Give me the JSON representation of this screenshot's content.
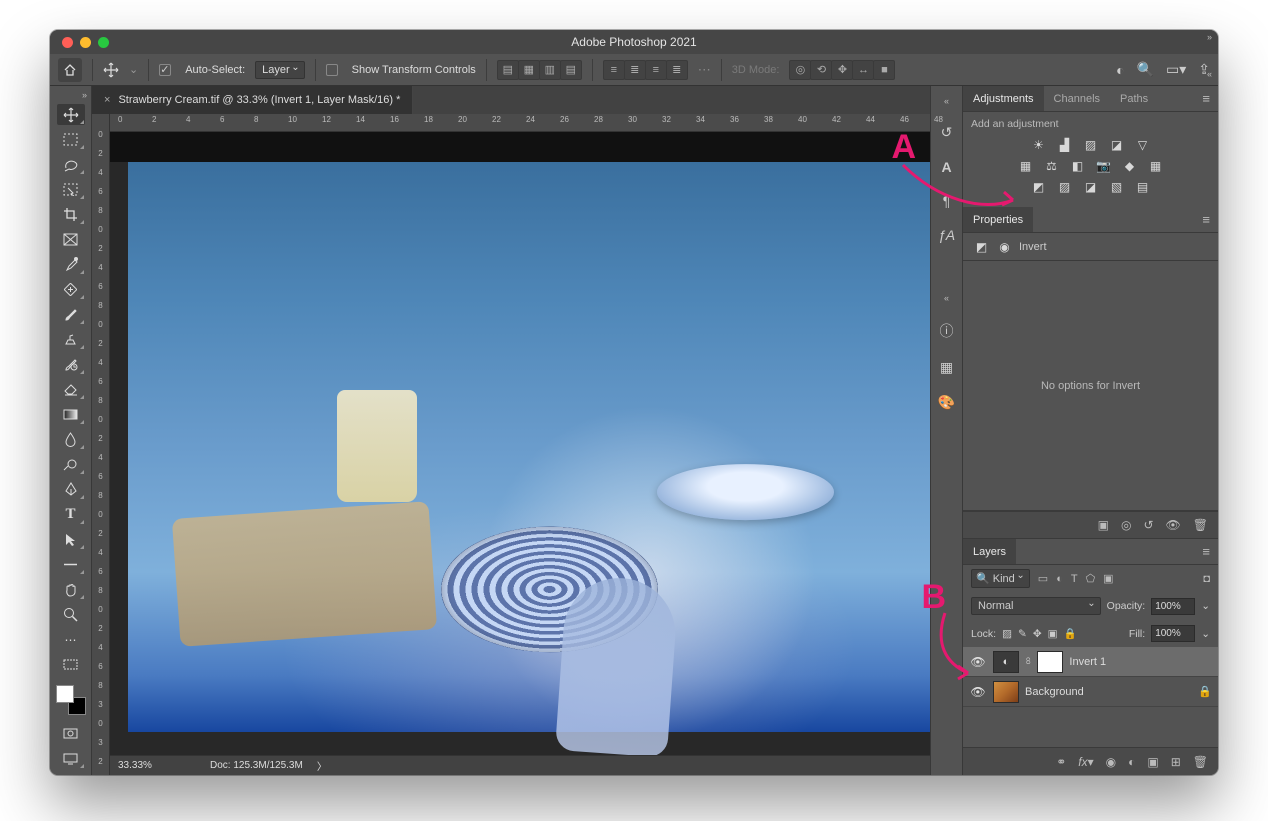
{
  "traffic": [
    "close",
    "minimize",
    "zoom"
  ],
  "titlebar": "Adobe Photoshop 2021",
  "optionsbar": {
    "auto_select": {
      "checked": true,
      "label": "Auto-Select:"
    },
    "target": "Layer",
    "show_transform": {
      "checked": false,
      "label": "Show Transform Controls"
    },
    "mode3d_label": "3D Mode:"
  },
  "document": {
    "tab": "Strawberry Cream.tif @ 33.3% (Invert 1, Layer Mask/16) *",
    "zoom": "33.33%",
    "doc_size": "Doc: 125.3M/125.3M"
  },
  "ruler_h": [
    "0",
    "2",
    "4",
    "6",
    "8",
    "10",
    "12",
    "14",
    "16",
    "18",
    "20",
    "22",
    "24",
    "26",
    "28",
    "30",
    "32",
    "34",
    "36",
    "38",
    "40",
    "42",
    "44",
    "46",
    "48"
  ],
  "ruler_v": [
    "0",
    "2",
    "4",
    "6",
    "8",
    "0",
    "2",
    "4",
    "6",
    "8",
    "0",
    "2",
    "4",
    "6",
    "8",
    "0",
    "2",
    "4",
    "6",
    "8",
    "0",
    "2",
    "4",
    "6",
    "8",
    "0",
    "2",
    "4",
    "6",
    "8",
    "3",
    "0",
    "3",
    "2"
  ],
  "collapsed_icons": {
    "row1": [
      "history-icon",
      "character-icon",
      "paragraph-icon",
      "glyphs-icon"
    ],
    "row2": [
      "info-icon",
      "swatches-icon",
      "color-icon"
    ]
  },
  "adjustments_panel": {
    "tabs": [
      "Adjustments",
      "Channels",
      "Paths"
    ],
    "active": 0,
    "add_label": "Add an adjustment",
    "row1": [
      "brightness",
      "levels",
      "curves",
      "exposure",
      "vibrance"
    ],
    "row2": [
      "hue",
      "balance",
      "bw",
      "photo-filter",
      "mixer",
      "lut"
    ],
    "row3": [
      "invert",
      "posterize",
      "threshold",
      "selective",
      "gradient-map"
    ]
  },
  "properties_panel": {
    "tab": "Properties",
    "type": "Invert",
    "body": "No options for Invert"
  },
  "layers_strip_icons": [
    "align",
    "fx-visible",
    "reset",
    "visibility",
    "delete"
  ],
  "layers_panel": {
    "tab": "Layers",
    "filter_label": "Kind",
    "filter_icons": [
      "pixel-filter",
      "adj-filter",
      "type-filter",
      "shape-filter",
      "smart-filter",
      "toggle"
    ],
    "blend": "Normal",
    "opacity_label": "Opacity:",
    "opacity": "100%",
    "lock_label": "Lock:",
    "fill_label": "Fill:",
    "fill": "100%",
    "layers": [
      {
        "name": "Invert 1",
        "type": "adjustment",
        "selected": true,
        "locked": false
      },
      {
        "name": "Background",
        "type": "image",
        "selected": false,
        "locked": true
      }
    ],
    "footer_icons": [
      "link",
      "fx",
      "mask",
      "adj",
      "group",
      "new",
      "trash"
    ]
  },
  "callouts": {
    "A": "A",
    "B": "B"
  }
}
